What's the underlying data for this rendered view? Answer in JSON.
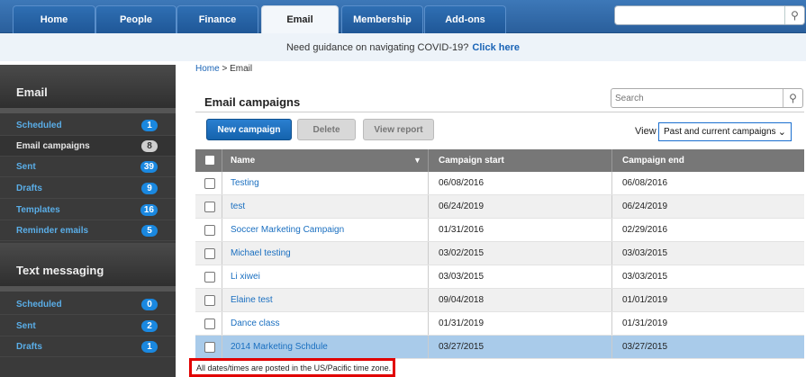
{
  "nav": {
    "tabs": [
      "Home",
      "People",
      "Finance",
      "Email",
      "Membership",
      "Add-ons"
    ],
    "active_tab": "Email"
  },
  "banner": {
    "text": "Need guidance on navigating COVID-19?",
    "link": "Click here"
  },
  "sidebar": {
    "email_heading": "Email",
    "email_items": [
      {
        "label": "Scheduled",
        "count": "1"
      },
      {
        "label": "Email campaigns",
        "count": "8"
      },
      {
        "label": "Sent",
        "count": "39"
      },
      {
        "label": "Drafts",
        "count": "9"
      },
      {
        "label": "Templates",
        "count": "16"
      },
      {
        "label": "Reminder emails",
        "count": "5"
      }
    ],
    "text_heading": "Text messaging",
    "text_items": [
      {
        "label": "Scheduled",
        "count": "0"
      },
      {
        "label": "Sent",
        "count": "2"
      },
      {
        "label": "Drafts",
        "count": "1"
      }
    ]
  },
  "breadcrumb": {
    "home": "Home",
    "sep": ">",
    "current": "Email"
  },
  "page": {
    "title": "Email campaigns",
    "search_placeholder": "Search",
    "buttons": {
      "new": "New campaign",
      "delete": "Delete",
      "view": "View report"
    },
    "view_label": "View",
    "view_value": "Past and current campaigns"
  },
  "table": {
    "headers": [
      "Name",
      "Campaign start",
      "Campaign end"
    ],
    "rows": [
      [
        "Testing",
        "06/08/2016",
        "06/08/2016"
      ],
      [
        "test",
        "06/24/2019",
        "06/24/2019"
      ],
      [
        "Soccer Marketing Campaign",
        "01/31/2016",
        "02/29/2016"
      ],
      [
        "Michael testing",
        "03/02/2015",
        "03/03/2015"
      ],
      [
        "Li xiwei",
        "03/03/2015",
        "03/03/2015"
      ],
      [
        "Elaine test",
        "09/04/2018",
        "01/01/2019"
      ],
      [
        "Dance class",
        "01/31/2019",
        "01/31/2019"
      ],
      [
        "2014 Marketing Schdule",
        "03/27/2015",
        "03/27/2015"
      ]
    ]
  },
  "footer_note": "All dates/times are posted in the US/Pacific time zone."
}
